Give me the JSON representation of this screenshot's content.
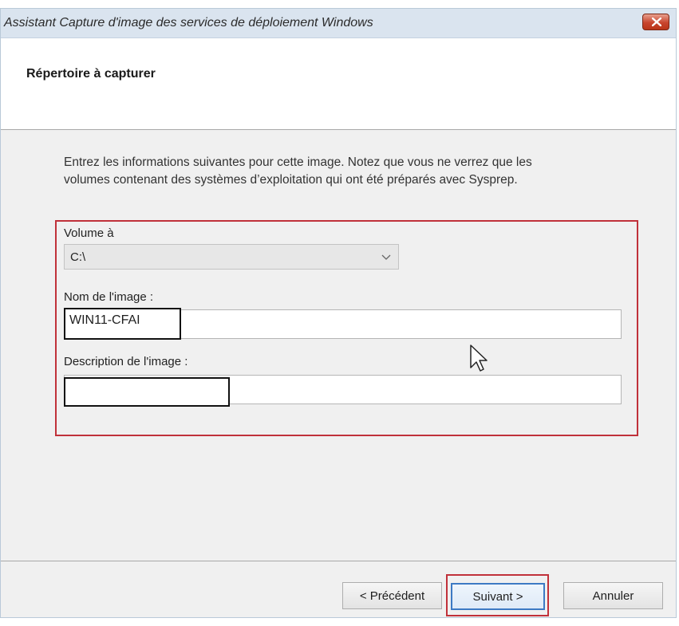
{
  "window": {
    "title": "Assistant Capture d'image des services de déploiement Windows",
    "close_icon": "close-icon"
  },
  "header": {
    "heading": "Répertoire à capturer"
  },
  "instructions": {
    "line1": "Entrez les informations suivantes pour cette image. Notez que vous ne verrez que les",
    "line2": "volumes contenant des systèmes d’exploitation qui ont été préparés avec Sysprep."
  },
  "form": {
    "volume": {
      "label": "Volume à",
      "selected": "C:\\"
    },
    "image_name": {
      "label": "Nom de l'image :",
      "value": "WIN11-CFAI"
    },
    "image_description": {
      "label": "Description de l'image :",
      "value": ""
    }
  },
  "buttons": {
    "previous": "< Précédent",
    "next": "Suivant >",
    "cancel": "Annuler"
  },
  "colors": {
    "highlight": "#c0313a",
    "focus": "#3d7ac4",
    "titlebar": "#dae4ef"
  }
}
